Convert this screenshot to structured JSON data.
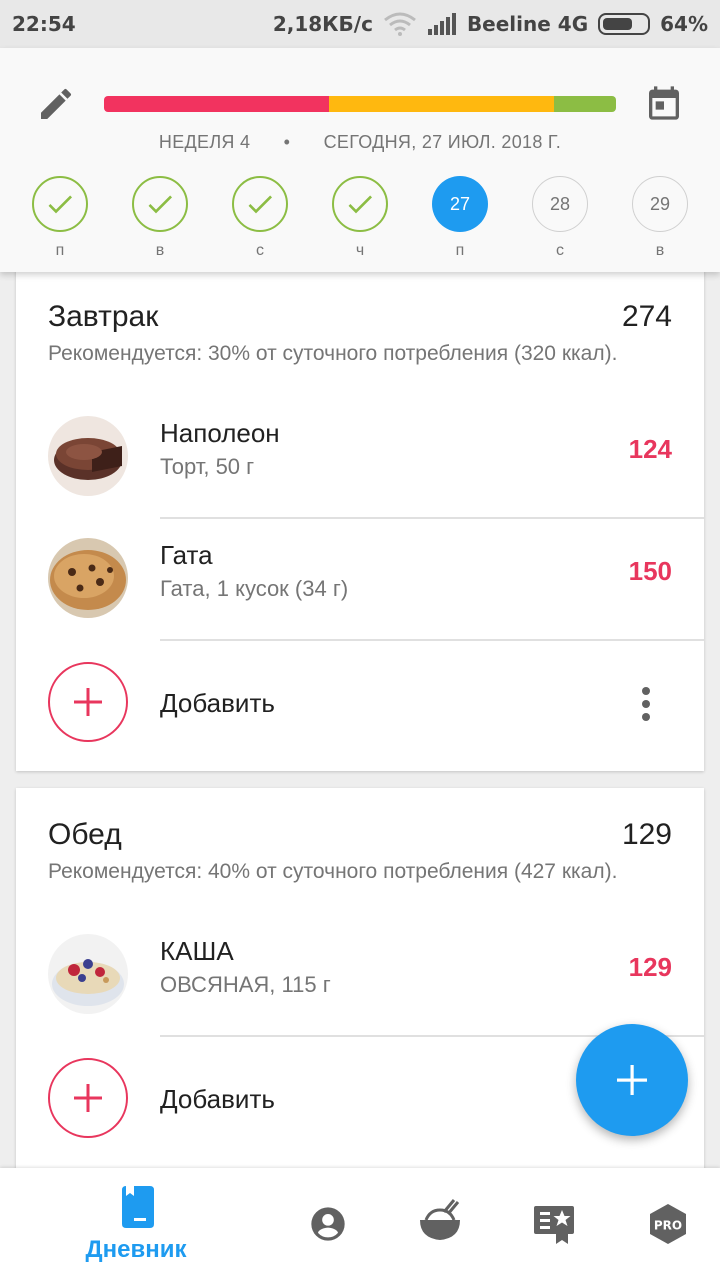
{
  "status_bar": {
    "time": "22:54",
    "speed": "2,18КБ/с",
    "carrier": "Beeline 4G",
    "battery": "64%"
  },
  "header": {
    "week": "НЕДЕЛЯ 4",
    "separator": "•",
    "date": "СЕГОДНЯ, 27 ИЮЛ. 2018 Г.",
    "days": [
      {
        "label": "п",
        "state": "done"
      },
      {
        "label": "в",
        "state": "done"
      },
      {
        "label": "с",
        "state": "done"
      },
      {
        "label": "ч",
        "state": "done"
      },
      {
        "label": "п",
        "number": "27",
        "state": "today"
      },
      {
        "label": "с",
        "number": "28",
        "state": "future"
      },
      {
        "label": "в",
        "number": "29",
        "state": "future"
      }
    ]
  },
  "meals": {
    "breakfast": {
      "title": "Завтрак",
      "total": "274",
      "recommendation": "Рекомендуется: 30% от суточного потребления (320 ккал).",
      "items": [
        {
          "name": "Наполеон",
          "desc": "Торт, 50 г",
          "kcal": "124"
        },
        {
          "name": "Гата",
          "desc": "Гата, 1 кусок (34 г)",
          "kcal": "150"
        }
      ],
      "add_label": "Добавить"
    },
    "lunch": {
      "title": "Обед",
      "total": "129",
      "recommendation": "Рекомендуется: 40% от суточного потребления (427 ккал).",
      "items": [
        {
          "name": "КАША",
          "desc": "ОВСЯНАЯ, 115 г",
          "kcal": "129"
        }
      ],
      "add_label": "Добавить"
    }
  },
  "bottom_nav": {
    "diary_label": "Дневник",
    "pro_label": "PRO"
  },
  "colors": {
    "accent": "#1e9bf0",
    "kcal": "#e8365d",
    "progress_red": "#f2335f",
    "progress_yellow": "#ffb80f",
    "progress_green": "#8cbd44"
  }
}
